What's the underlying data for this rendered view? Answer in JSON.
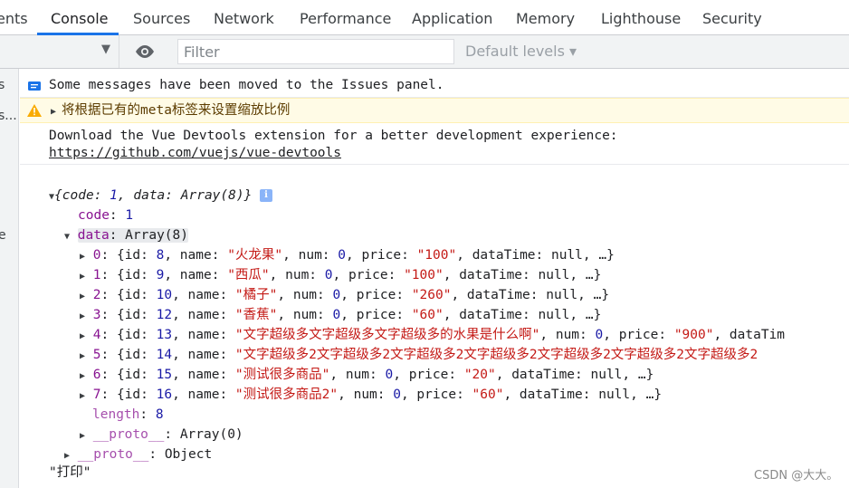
{
  "tabs": [
    {
      "label": "ents"
    },
    {
      "label": "Console"
    },
    {
      "label": "Sources"
    },
    {
      "label": "Network"
    },
    {
      "label": "Performance"
    },
    {
      "label": "Application"
    },
    {
      "label": "Memory"
    },
    {
      "label": "Lighthouse"
    },
    {
      "label": "Security"
    }
  ],
  "toolbar": {
    "filter_placeholder": "Filter",
    "levels_label": "Default levels ▾"
  },
  "sidebar_fragments": [
    "s",
    "s...",
    "e"
  ],
  "messages": {
    "info": "Some messages have been moved to the Issues panel.",
    "warning": "将根据已有的meta标签来设置缩放比例",
    "devtools_line1": "Download the Vue Devtools extension for a better development experience:",
    "devtools_link": "https://github.com/vuejs/vue-devtools"
  },
  "object": {
    "summary_open": "{",
    "code_key": "code",
    "code_val": "1",
    "data_key": "data",
    "data_val": "Array(8)",
    "summary_close": "}",
    "info_badge": "i",
    "items": [
      {
        "index": "0",
        "id": "8",
        "name": "\"火龙果\"",
        "num": "0",
        "price": "\"100\"",
        "tail": ", dataTime: null, …}"
      },
      {
        "index": "1",
        "id": "9",
        "name": "\"西瓜\"",
        "num": "0",
        "price": "\"100\"",
        "tail": ", dataTime: null, …}"
      },
      {
        "index": "2",
        "id": "10",
        "name": "\"橘子\"",
        "num": "0",
        "price": "\"260\"",
        "tail": ", dataTime: null, …}"
      },
      {
        "index": "3",
        "id": "12",
        "name": "\"香蕉\"",
        "num": "0",
        "price": "\"60\"",
        "tail": ", dataTime: null, …}"
      },
      {
        "index": "4",
        "id": "13",
        "name": "\"文字超级多文字超级多文字超级多的水果是什么啊\"",
        "num": "0",
        "price": "\"900\"",
        "tail": ", dataTim"
      },
      {
        "index": "5",
        "id": "14",
        "name": "\"文字超级多2文字超级多2文字超级多2文字超级多2文字超级多2文字超级多2文字超级多2",
        "num": "",
        "price": "",
        "tail": ""
      },
      {
        "index": "6",
        "id": "15",
        "name": "\"测试很多商品\"",
        "num": "0",
        "price": "\"20\"",
        "tail": ", dataTime: null, …}"
      },
      {
        "index": "7",
        "id": "16",
        "name": "\"测试很多商品2\"",
        "num": "0",
        "price": "\"60\"",
        "tail": ", dataTime: null, …}"
      }
    ],
    "length_key": "length",
    "length_val": "8",
    "proto_array_key": "__proto__",
    "proto_array_val": "Array(0)",
    "proto_obj_key": "__proto__",
    "proto_obj_val": "Object"
  },
  "printed": "\"打印\"",
  "watermark": "CSDN @大大。",
  "colors": {
    "accent": "#1a73e8",
    "key": "#881391",
    "number": "#1a1aa6",
    "string": "#c41a16",
    "warning_bg": "#fffbe6"
  }
}
